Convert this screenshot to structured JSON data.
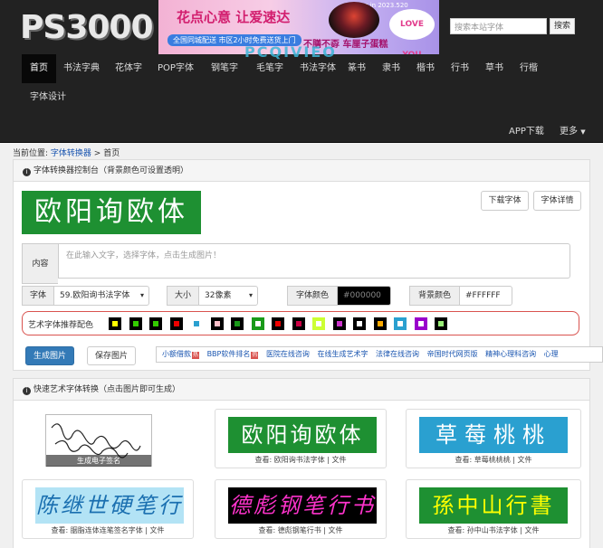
{
  "header": {
    "logo": "PS3000",
    "banner": {
      "headline": "花点心意 让爱速达",
      "ribbon": "全国同城配送 市区2小时免费送货上门",
      "tag": "不膳不孬 车厘子蛋糕",
      "love_badge": "LOVE YOU",
      "date_note": "Love in 2023.520"
    },
    "watermark": "PCQIVIEO",
    "search": {
      "placeholder": "搜索本站字体",
      "button": "搜索"
    },
    "nav": [
      {
        "label": "首页"
      },
      {
        "label": "书法字典"
      },
      {
        "label": "花体字"
      },
      {
        "label": "POP字体"
      },
      {
        "label": "钢笔字"
      },
      {
        "label": "毛笔字"
      },
      {
        "label": "书法字体"
      },
      {
        "label": "篆书"
      },
      {
        "label": "隶书"
      },
      {
        "label": "楷书"
      },
      {
        "label": "行书"
      },
      {
        "label": "草书"
      },
      {
        "label": "行楷"
      },
      {
        "label": "字体设计"
      }
    ],
    "app_download": "APP下载",
    "more": "更多"
  },
  "breadcrumb": {
    "prefix": "当前位置:",
    "section": "字体转换器",
    "sep": " > ",
    "current": "首页"
  },
  "console": {
    "title": "字体转换器控制台（背景颜色可设置透明）",
    "preview_text": "欧阳询欧体",
    "preview_bg": "#1e9032",
    "download_btn": "下载字体",
    "detail_btn": "字体详情",
    "content_label": "内容",
    "content_placeholder": "在此输入文字，选择字体，点击生成图片！",
    "font_label": "字体",
    "font_value": "59.欧阳询书法字体",
    "size_label": "大小",
    "size_value": "32像素",
    "color_label": "字体颜色",
    "color_value": "#000000",
    "bg_label": "背景颜色",
    "bg_value": "#FFFFFF",
    "recommend_label": "艺术字体推荐配色",
    "swatches": [
      {
        "outer": "#000000",
        "inner": "#ffff00"
      },
      {
        "outer": "#000000",
        "inner": "#33cc00"
      },
      {
        "outer": "#000000",
        "inner": "#33cc00"
      },
      {
        "outer": "#000000",
        "inner": "#ee0000"
      },
      {
        "outer": "#ffffff",
        "inner": "#2aa0d0"
      },
      {
        "outer": "#000000",
        "inner": "#ffc0cb"
      },
      {
        "outer": "#000000",
        "inner": "#1a9a1a"
      },
      {
        "outer": "#1a9a1a",
        "inner": "#ffffff"
      },
      {
        "outer": "#000000",
        "inner": "#ee0000"
      },
      {
        "outer": "#000000",
        "inner": "#cc0044"
      },
      {
        "outer": "#ccff33",
        "inner": "#ffffff"
      },
      {
        "outer": "#000000",
        "inner": "#cc33cc"
      },
      {
        "outer": "#000000",
        "inner": "#ffffff"
      },
      {
        "outer": "#000000",
        "inner": "#ffaa00"
      },
      {
        "outer": "#2aa0d0",
        "inner": "#ffffff"
      },
      {
        "outer": "#9900cc",
        "inner": "#ffffff"
      },
      {
        "outer": "#000000",
        "inner": "#99ee77"
      }
    ],
    "generate_btn": "生成图片",
    "save_btn": "保存图片",
    "ad_links": [
      "小额借款",
      "BBP软件排名",
      "医院在线咨询",
      "在线生成艺术字",
      "法律在线咨询",
      "帝国时代网页版",
      "精神心理科咨询",
      "心理"
    ],
    "hot_badge": "热"
  },
  "quick": {
    "title": "快速艺术字体转换（点击图片即可生成）",
    "cards": [
      {
        "art": "签名",
        "overlay": "生成电子签名",
        "caption": ""
      },
      {
        "art": "欧阳询欧体",
        "overlay": "",
        "caption": "查看: 欧阳询书法字体 | 文件",
        "bg": "#1e9032",
        "fg": "#ffffff"
      },
      {
        "art": "草莓桃桃",
        "overlay": "",
        "caption": "查看: 草莓桃桃桃 | 文件",
        "bg": "#2aa0d0",
        "fg": "#ffffff"
      },
      {
        "art": "陈继世硬笔行",
        "overlay": "",
        "caption": "查看: 胭脂连体连笔签名字体 | 文件",
        "bg": "#b3e3f5",
        "fg": "#1a6fb0"
      },
      {
        "art": "德彪钢笔行书",
        "overlay": "",
        "caption": "查看: 德彪钢笔行书 | 文件",
        "bg": "#000000",
        "fg": "#ff33cc"
      },
      {
        "art": "孫中山行書",
        "overlay": "",
        "caption": "查看: 孙中山书法字体 | 文件",
        "bg": "#1e9032",
        "fg": "#ffff00"
      }
    ]
  }
}
